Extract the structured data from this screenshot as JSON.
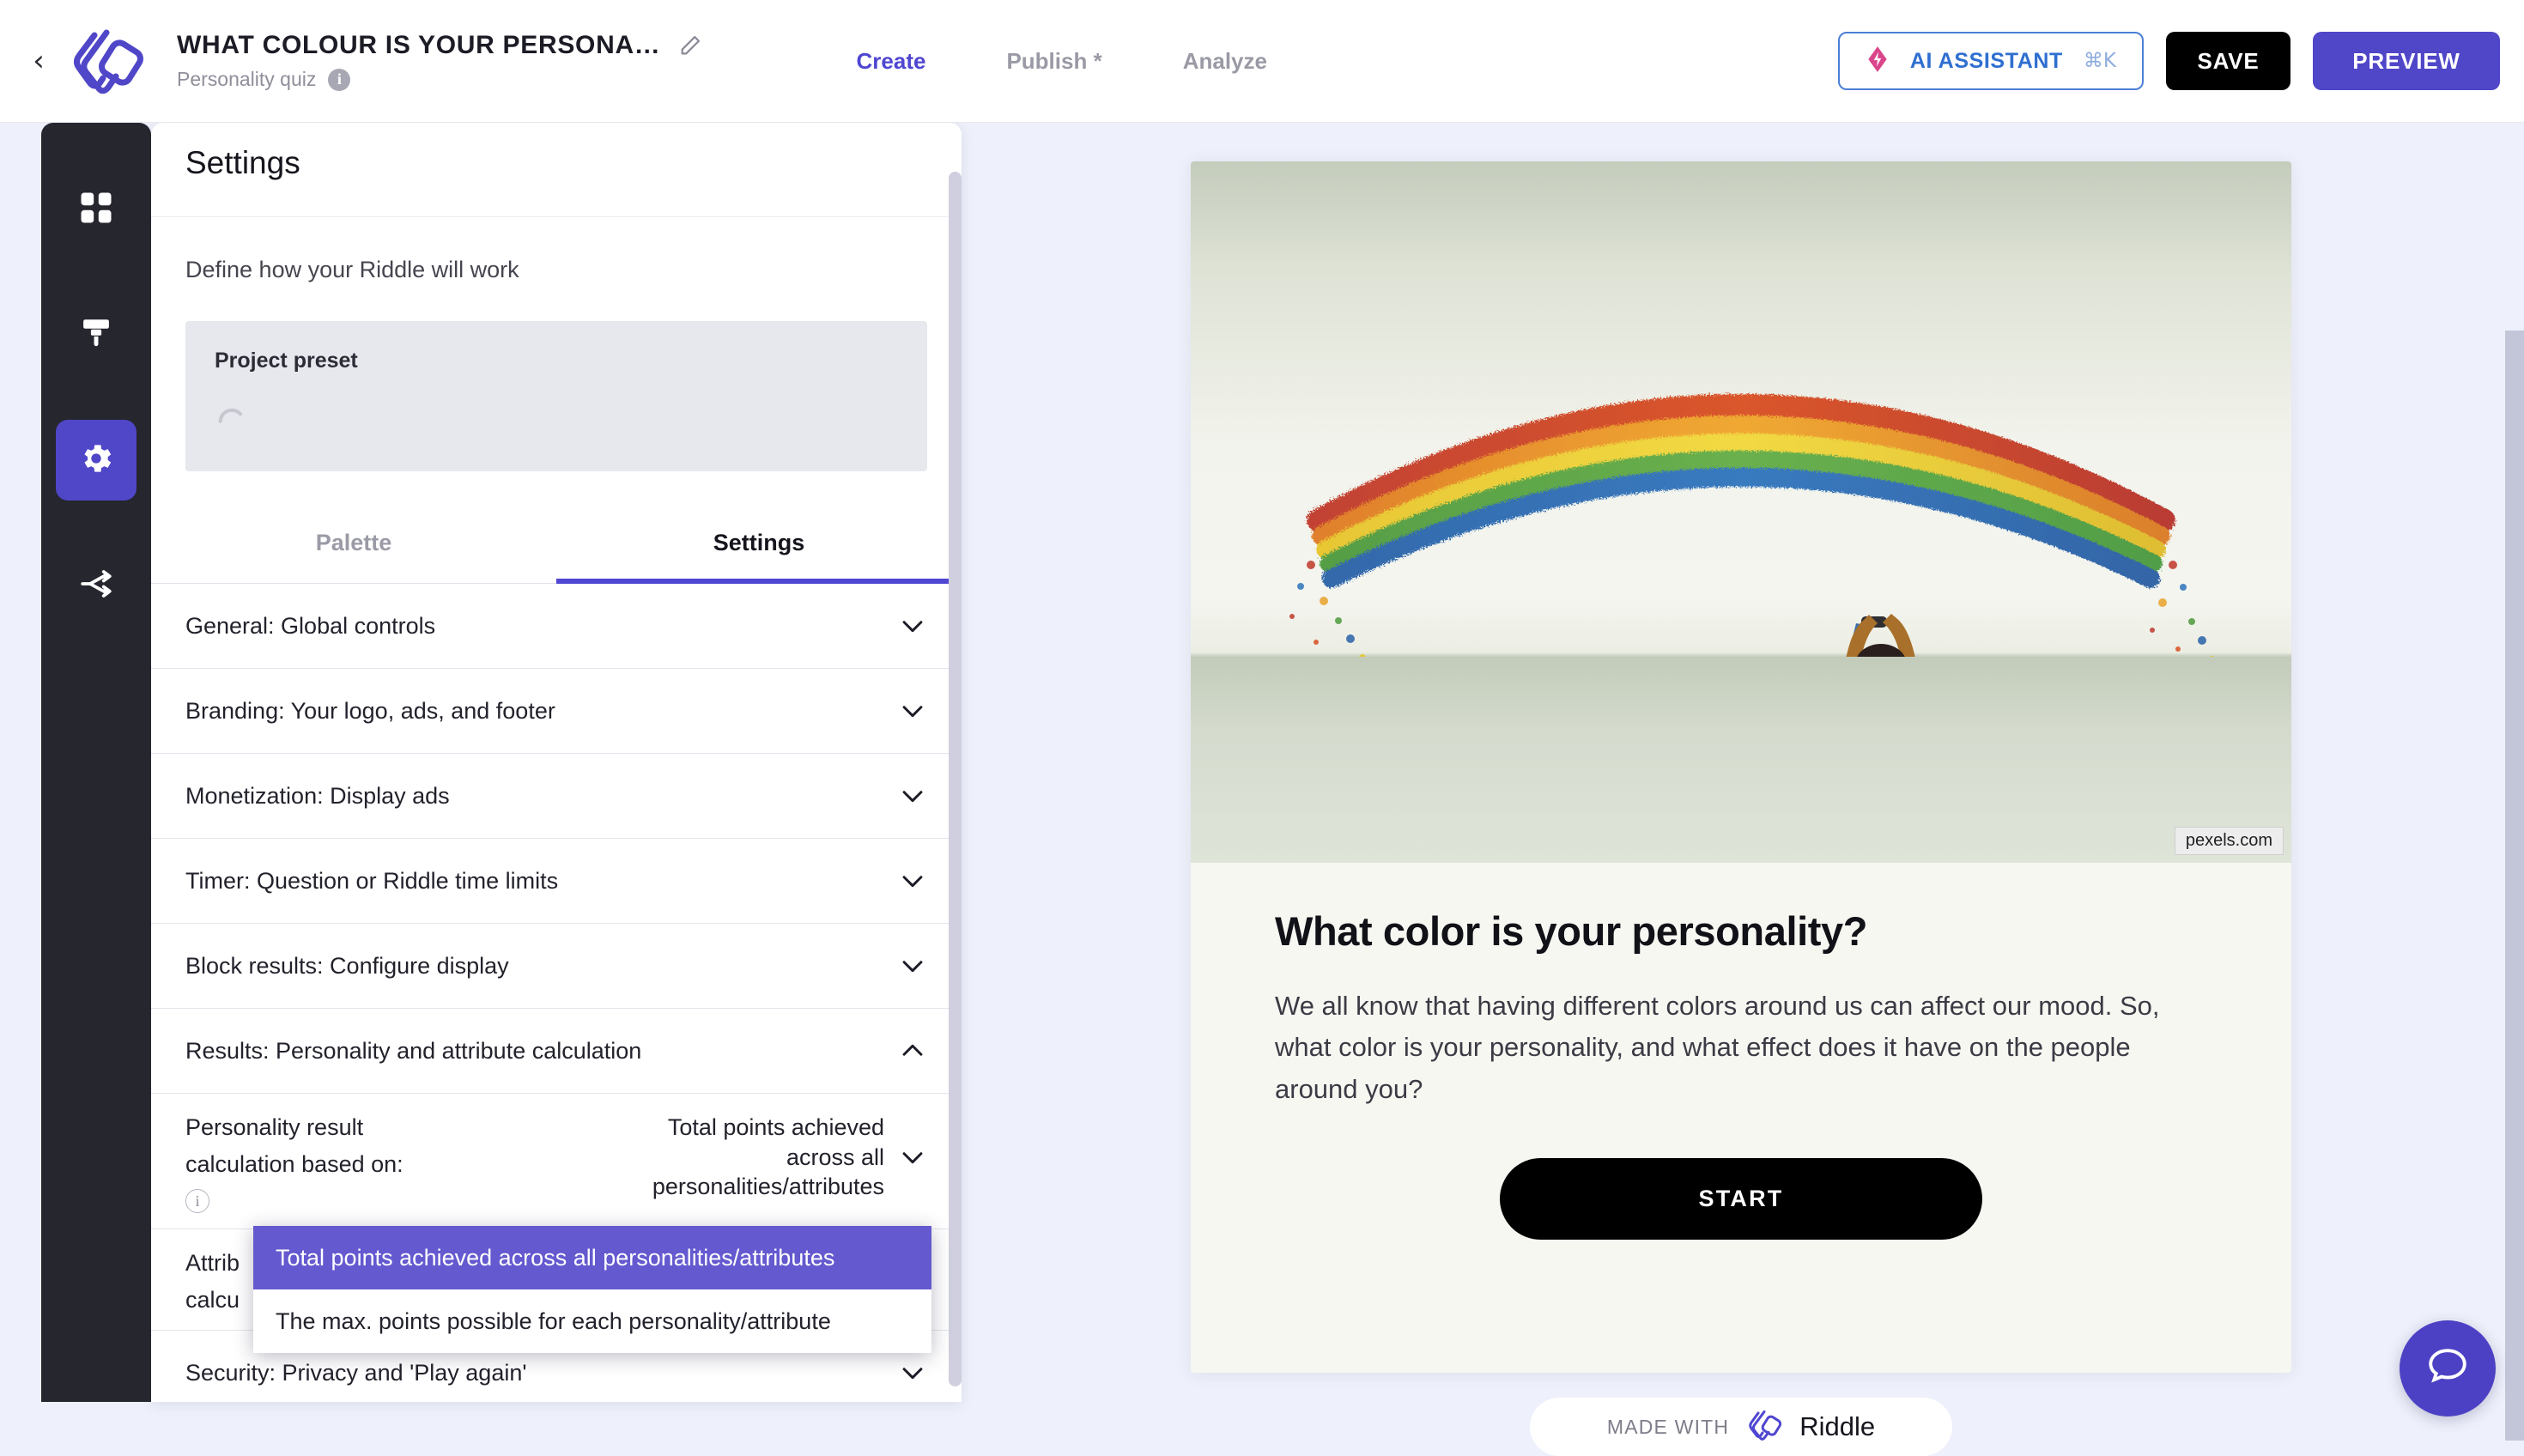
{
  "header": {
    "back_icon": "chevron-left-icon",
    "logo_icon": "riddle-logo-icon",
    "project_title": "WHAT COLOUR IS YOUR PERSONA…",
    "edit_icon": "pencil-icon",
    "project_type": "Personality quiz",
    "info_icon": "info-icon",
    "nav": [
      {
        "label": "Create",
        "active": true
      },
      {
        "label": "Publish *",
        "active": false
      },
      {
        "label": "Analyze",
        "active": false
      }
    ],
    "ai_assistant": {
      "label": "AI ASSISTANT",
      "shortcut": "⌘K",
      "icon": "sparkle-diamond-icon"
    },
    "save_label": "SAVE",
    "preview_label": "PREVIEW"
  },
  "rail": {
    "items": [
      {
        "name": "blocks-grid-icon",
        "active": false
      },
      {
        "name": "paintbrush-icon",
        "active": false
      },
      {
        "name": "gear-icon",
        "active": true
      },
      {
        "name": "share-nodes-icon",
        "active": false
      }
    ]
  },
  "panel": {
    "title": "Settings",
    "description": "Define how your Riddle will work",
    "preset": {
      "label": "Project preset",
      "spinner_icon": "loading-spinner-icon"
    },
    "tabs": [
      {
        "label": "Palette",
        "active": false
      },
      {
        "label": "Settings",
        "active": true
      }
    ],
    "accordions": [
      {
        "label": "General: Global controls",
        "expanded": false,
        "chevron": "chevron-down-icon"
      },
      {
        "label": "Branding: Your logo, ads, and footer",
        "expanded": false,
        "chevron": "chevron-down-icon"
      },
      {
        "label": "Monetization: Display ads",
        "expanded": false,
        "chevron": "chevron-down-icon"
      },
      {
        "label": "Timer: Question or Riddle time limits",
        "expanded": false,
        "chevron": "chevron-down-icon"
      },
      {
        "label": "Block results: Configure display",
        "expanded": false,
        "chevron": "chevron-down-icon"
      },
      {
        "label": "Results: Personality and attribute calculation",
        "expanded": true,
        "chevron": "chevron-up-icon"
      }
    ],
    "personality_row": {
      "label_line1": "Personality result",
      "label_line2": "calculation based on:",
      "info_icon": "info-icon",
      "value": "Total points achieved across all personalities/attributes",
      "chevron": "chevron-down-icon"
    },
    "attribute_row": {
      "label_line1": "Attrib",
      "label_line2": "calcu"
    },
    "security_row": {
      "label": "Security: Privacy and 'Play again'"
    },
    "dropdown": {
      "options": [
        {
          "label": "Total points achieved across all personalities/attributes",
          "selected": true
        },
        {
          "label": "The max. points possible for each personality/attribute",
          "selected": false
        }
      ]
    }
  },
  "preview": {
    "image_credit": "pexels.com",
    "image_alt": "woman photographing rainbow dot wall art",
    "title": "What color is your personality?",
    "body": "We all know that having different colors around us can affect our mood. So, what color is your personality, and what effect does it have on the people around you?",
    "start_label": "START",
    "made_with_label": "MADE WITH",
    "made_with_brand": "Riddle"
  },
  "chat": {
    "icon": "chat-bubble-icon"
  },
  "colors": {
    "accent": "#5046c8",
    "nav_active": "#4f46d1",
    "dropdown_selected": "#6459cf",
    "rail_bg": "#26262f",
    "page_bg": "#eef0fb",
    "ai_border": "#4b7fd6",
    "ai_text": "#2f6fd0"
  }
}
